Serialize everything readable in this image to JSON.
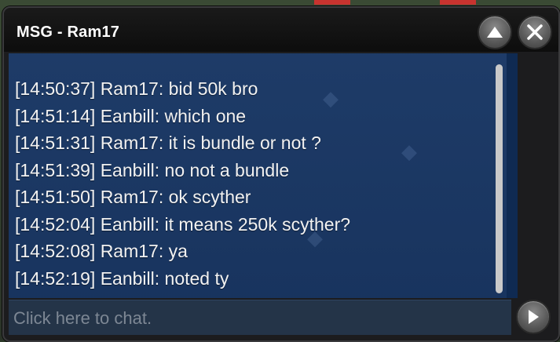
{
  "window": {
    "title": "MSG - Ram17"
  },
  "buttons": {
    "collapse_icon": "triangle-up-icon",
    "close_icon": "x-icon",
    "send_icon": "triangle-right-icon"
  },
  "messages": [
    "[14:50:37] Ram17: bid 50k bro",
    "[14:51:14] Eanbill: which one",
    "[14:51:31] Ram17: it is bundle or not ?",
    "[14:51:39] Eanbill: no not a bundle",
    "[14:51:50] Ram17: ok scyther",
    "[14:52:04] Eanbill: it means 250k scyther?",
    "[14:52:08] Ram17: ya",
    "[14:52:19] Eanbill: noted ty"
  ],
  "chat_input": {
    "placeholder": "Click here to chat.",
    "value": ""
  },
  "colors": {
    "chat_bg": "#1e3e6e",
    "text": "#f2f2f2",
    "window_frame": "#1c1c1e"
  }
}
